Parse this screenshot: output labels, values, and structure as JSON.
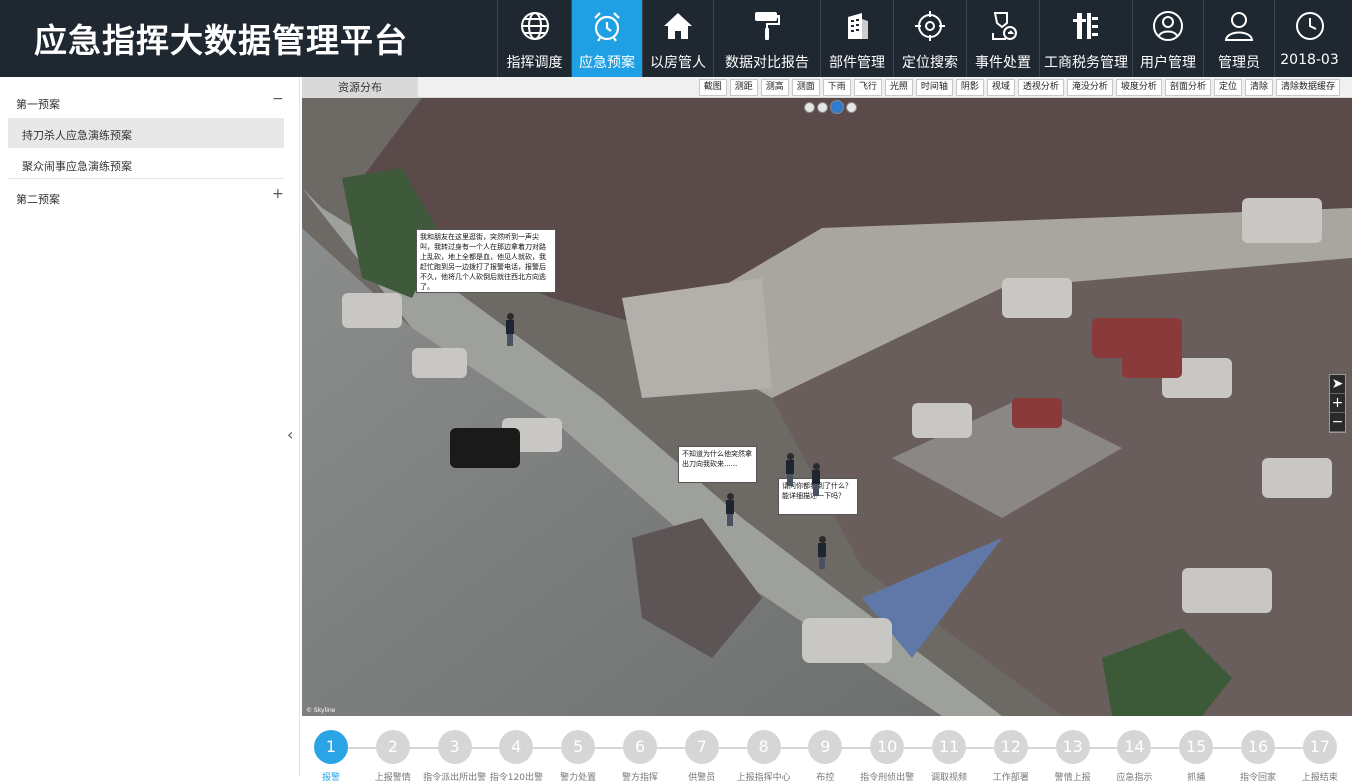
{
  "app": {
    "title": "应急指挥大数据管理平台"
  },
  "nav": [
    {
      "label": "指挥调度",
      "icon": "globe-icon",
      "active": false
    },
    {
      "label": "应急预案",
      "icon": "alarm-clock-icon",
      "active": true
    },
    {
      "label": "以房管人",
      "icon": "house-icon",
      "active": false
    },
    {
      "label": "数据对比报告",
      "icon": "paint-roller-icon",
      "active": false
    },
    {
      "label": "部件管理",
      "icon": "building-icon",
      "active": false
    },
    {
      "label": "定位搜索",
      "icon": "target-icon",
      "active": false
    },
    {
      "label": "事件处置",
      "icon": "event-handling-icon",
      "active": false
    },
    {
      "label": "工商税务管理",
      "icon": "tax-icon",
      "active": false
    },
    {
      "label": "用户管理",
      "icon": "user-circle-icon",
      "active": false
    },
    {
      "label": "管理员",
      "icon": "admin-user-icon",
      "active": false
    },
    {
      "label": "2018-03",
      "icon": "clock-icon",
      "active": false
    }
  ],
  "sidebar": {
    "groups": [
      {
        "label": "第一预案",
        "toggle": "−",
        "items": [
          "持刀杀人应急演练预案",
          "聚众闹事应急演练预案"
        ]
      },
      {
        "label": "第二预案",
        "toggle": "+",
        "items": []
      }
    ],
    "collapse_arrow": "‹"
  },
  "map": {
    "tab": "资源分布",
    "tools": [
      "截图",
      "测距",
      "测高",
      "测面",
      "下雨",
      "飞行",
      "光照",
      "时间轴",
      "阴影",
      "视域",
      "透视分析",
      "淹没分析",
      "坡度分析",
      "剖面分析",
      "定位",
      "清除",
      "清除数据缓存"
    ],
    "zoom": [
      "➤",
      "+",
      "−"
    ],
    "watermark": "© Skyline",
    "bubbles": [
      "我和朋友在这里逛街，突然听到一声尖叫，我转过身有一个人在那边拿着刀对路上乱砍，地上全都是血，他见人就砍，我赶忙跑到另一边拨打了报警电话，报警后不久，他将几个人砍倒后就往西北方向逃了。",
      "不知道为什么他突然拿出刀向我砍来......",
      "请问你都看到了什么？能详细描述一下吗？"
    ]
  },
  "steps": {
    "numbers": [
      "1",
      "2",
      "3",
      "4",
      "5",
      "6",
      "7",
      "8",
      "9",
      "10",
      "11",
      "12",
      "13",
      "14",
      "15",
      "16",
      "17"
    ],
    "labels": [
      "报警",
      "上报警情",
      "指令派出所出警",
      "指令120出警",
      "警力处置",
      "警方指挥",
      "供警员",
      "上报指挥中心",
      "布控",
      "指令刑侦出警",
      "调取视频",
      "工作部署",
      "警情上报",
      "应急指示",
      "抓捕",
      "指令回家",
      "上报结束"
    ],
    "active_index": 0
  },
  "colors": {
    "accent": "#2ba4e6",
    "topbar": "#1f2731",
    "active_nav": "#1fa0e4"
  }
}
